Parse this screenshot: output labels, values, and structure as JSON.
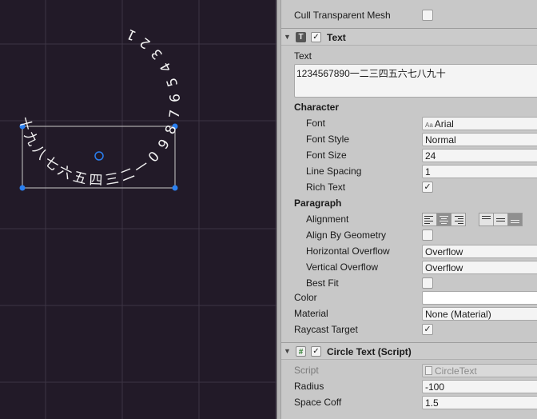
{
  "scene": {
    "text_chars": [
      "1",
      "2",
      "3",
      "4",
      "5",
      "6",
      "7",
      "8",
      "9",
      "0",
      "一",
      "二",
      "三",
      "四",
      "五",
      "六",
      "七",
      "八",
      "九",
      "十"
    ],
    "colors": {
      "background": "#221a28",
      "grid": "#3c3444",
      "text": "#f2f2f2",
      "rect": "#c9c9c9",
      "handle": "#2a7ff0"
    }
  },
  "inspector": {
    "cull_label": "Cull Transparent Mesh",
    "cull_checked": "",
    "text_component": {
      "title": "Text",
      "enabled_mark": "✓",
      "text_label": "Text",
      "text_value": "1234567890一二三四五六七八九十",
      "character_header": "Character",
      "font_label": "Font",
      "font_icon": "Aa",
      "font_value": "Arial",
      "font_style_label": "Font Style",
      "font_style_value": "Normal",
      "font_size_label": "Font Size",
      "font_size_value": "24",
      "line_spacing_label": "Line Spacing",
      "line_spacing_value": "1",
      "rich_text_label": "Rich Text",
      "rich_text_mark": "✓",
      "paragraph_header": "Paragraph",
      "alignment_label": "Alignment",
      "align_geometry_label": "Align By Geometry",
      "align_geometry_mark": "",
      "h_overflow_label": "Horizontal Overflow",
      "h_overflow_value": "Overflow",
      "v_overflow_label": "Vertical Overflow",
      "v_overflow_value": "Overflow",
      "best_fit_label": "Best Fit",
      "best_fit_mark": "",
      "color_label": "Color",
      "color_value": "#ffffff",
      "material_label": "Material",
      "material_value": "None (Material)",
      "raycast_label": "Raycast Target",
      "raycast_mark": "✓"
    },
    "circle_component": {
      "icon": "#",
      "title": "Circle Text (Script)",
      "enabled_mark": "✓",
      "script_label": "Script",
      "script_value": "CircleText",
      "radius_label": "Radius",
      "radius_value": "-100",
      "space_label": "Space Coff",
      "space_value": "1.5"
    }
  }
}
